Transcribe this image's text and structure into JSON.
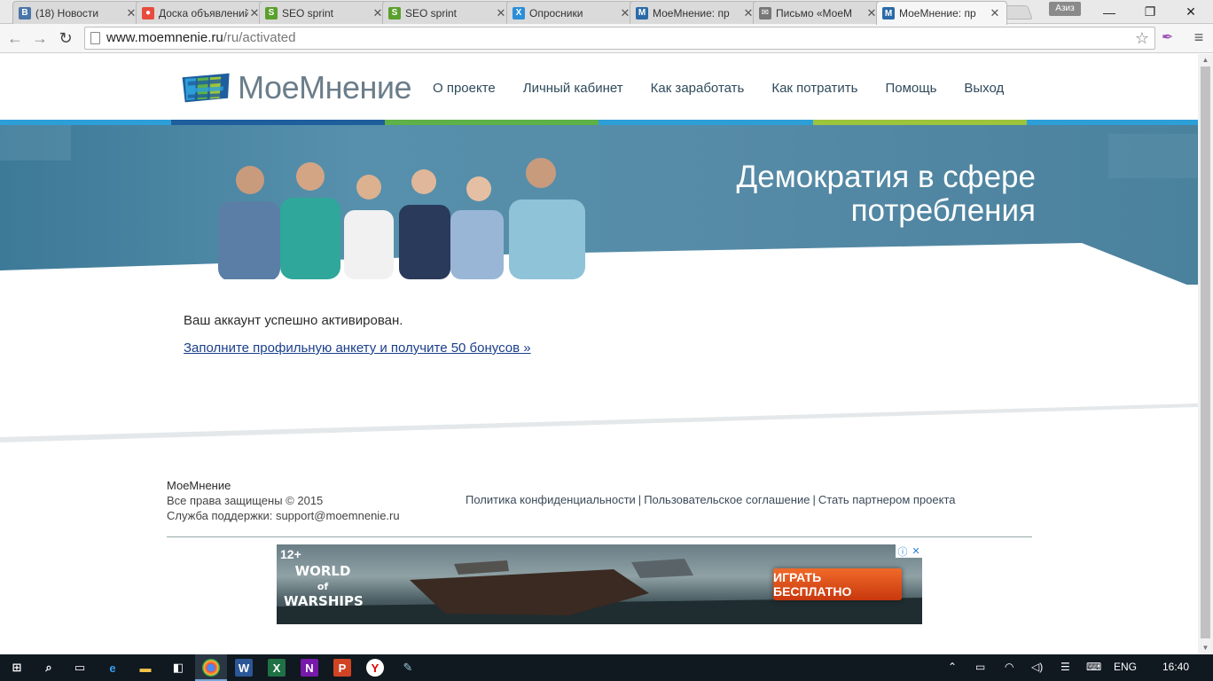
{
  "browser": {
    "tabs": [
      {
        "label": "(18) Новости",
        "icon": "vk-icon",
        "color": "#4a76a8",
        "active": false
      },
      {
        "label": "Доска объявлений",
        "icon": "board-icon",
        "color": "#e84c3d",
        "active": false
      },
      {
        "label": "SEO sprint",
        "icon": "seosprint-icon",
        "color": "#5aa02c",
        "active": false
      },
      {
        "label": "SEO sprint",
        "icon": "seosprint-icon",
        "color": "#5aa02c",
        "active": false
      },
      {
        "label": "Опросники",
        "icon": "x-icon",
        "color": "#2a8fd8",
        "active": false
      },
      {
        "label": "МоеМнение: пр",
        "icon": "moemnenie-icon",
        "color": "#2b6aa8",
        "active": false
      },
      {
        "label": "Письмо «МоеМ",
        "icon": "mail-icon",
        "color": "#777777",
        "active": false
      },
      {
        "label": "МоеМнение: пр",
        "icon": "moemnenie-icon",
        "color": "#2b6aa8",
        "active": true
      }
    ],
    "user_badge": "Азиз",
    "url_host": "www.moemnenie.ru",
    "url_path": "/ru/activated"
  },
  "site": {
    "logo_text": "МоеМнение",
    "nav": [
      "О проекте",
      "Личный кабинет",
      "Как заработать",
      "Как потратить",
      "Помощь",
      "Выход"
    ],
    "hero_title_line1": "Демократия в сфере",
    "hero_title_line2": "потребления",
    "message": "Ваш аккаунт успешно активирован.",
    "cta_link": "Заполните профильную анкету и получите 50 бонусов »",
    "footer": {
      "brand": "МоеМнение",
      "copyright": "Все права защищены © 2015",
      "support_label": "Служба поддержки: ",
      "support_email": "support@moemnenie.ru",
      "links": [
        "Политика конфиденциальности",
        "Пользовательское соглашение",
        "Стать партнером проекта"
      ],
      "separator": "|"
    },
    "ad": {
      "age": "12+",
      "game_line1": "WORLD",
      "game_line2": "of",
      "game_line3": "WARSHIPS",
      "button": "ИГРАТЬ БЕСПЛАТНО"
    }
  },
  "taskbar": {
    "lang": "ENG",
    "time": "16:40"
  },
  "colors": {
    "stripe_blue": "#2d9fd8",
    "stripe_dark": "#1f5e9c",
    "stripe_green": "#5db146",
    "stripe_lime": "#9cc43c",
    "hero": "#4e87a3"
  }
}
